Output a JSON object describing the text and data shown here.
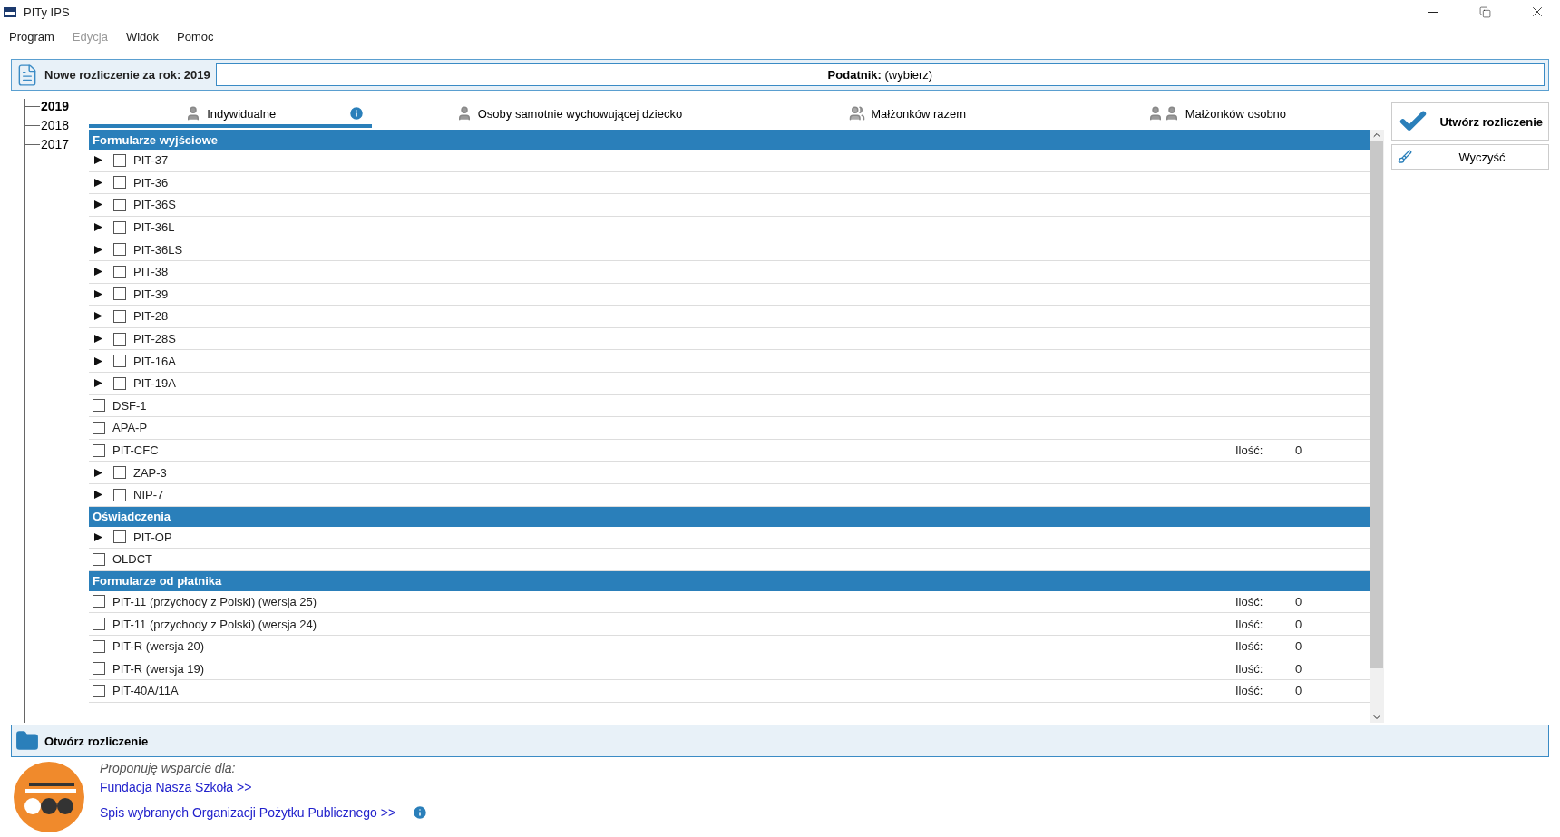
{
  "window": {
    "title": "PITy IPS"
  },
  "menu": [
    "Program",
    "Edycja",
    "Widok",
    "Pomoc"
  ],
  "menu_disabled": [
    false,
    true,
    false,
    false
  ],
  "header": {
    "title": "Nowe rozliczenie za rok: 2019",
    "taxpayer_label": "Podatnik:",
    "taxpayer_value": "(wybierz)"
  },
  "years": [
    {
      "label": "2019",
      "selected": true
    },
    {
      "label": "2018",
      "selected": false
    },
    {
      "label": "2017",
      "selected": false
    }
  ],
  "tabs": [
    {
      "label": "Indywidualne",
      "selected": true,
      "kind": "single",
      "info": true
    },
    {
      "label": "Osoby samotnie wychowującej dziecko",
      "selected": false,
      "kind": "single",
      "info": false
    },
    {
      "label": "Małżonków razem",
      "selected": false,
      "kind": "pair",
      "info": false
    },
    {
      "label": "Małżonków osobno",
      "selected": false,
      "kind": "apart",
      "info": false
    }
  ],
  "sections": [
    {
      "title": "Formularze wyjściowe",
      "items": [
        {
          "label": "PIT-37",
          "expandable": true,
          "checked": false
        },
        {
          "label": "PIT-36",
          "expandable": true,
          "checked": false
        },
        {
          "label": "PIT-36S",
          "expandable": true,
          "checked": false
        },
        {
          "label": "PIT-36L",
          "expandable": true,
          "checked": false
        },
        {
          "label": "PIT-36LS",
          "expandable": true,
          "checked": false
        },
        {
          "label": "PIT-38",
          "expandable": true,
          "checked": false
        },
        {
          "label": "PIT-39",
          "expandable": true,
          "checked": false
        },
        {
          "label": "PIT-28",
          "expandable": true,
          "checked": false
        },
        {
          "label": "PIT-28S",
          "expandable": true,
          "checked": false
        },
        {
          "label": "PIT-16A",
          "expandable": true,
          "checked": false
        },
        {
          "label": "PIT-19A",
          "expandable": true,
          "checked": false
        },
        {
          "label": "DSF-1",
          "expandable": false,
          "checked": false
        },
        {
          "label": "APA-P",
          "expandable": false,
          "checked": false
        },
        {
          "label": "PIT-CFC",
          "expandable": false,
          "checked": false,
          "quantity_label": "Ilość:",
          "quantity": "0"
        },
        {
          "label": "ZAP-3",
          "expandable": true,
          "checked": false
        },
        {
          "label": "NIP-7",
          "expandable": true,
          "checked": false
        }
      ]
    },
    {
      "title": "Oświadczenia",
      "items": [
        {
          "label": "PIT-OP",
          "expandable": true,
          "checked": false
        },
        {
          "label": "OLDCT",
          "expandable": false,
          "checked": false
        }
      ]
    },
    {
      "title": "Formularze od płatnika",
      "items": [
        {
          "label": "PIT-11 (przychody z Polski) (wersja 25)",
          "expandable": false,
          "checked": false,
          "quantity_label": "Ilość:",
          "quantity": "0"
        },
        {
          "label": "PIT-11 (przychody z Polski) (wersja 24)",
          "expandable": false,
          "checked": false,
          "quantity_label": "Ilość:",
          "quantity": "0"
        },
        {
          "label": "PIT-R (wersja 20)",
          "expandable": false,
          "checked": false,
          "quantity_label": "Ilość:",
          "quantity": "0"
        },
        {
          "label": "PIT-R (wersja 19)",
          "expandable": false,
          "checked": false,
          "quantity_label": "Ilość:",
          "quantity": "0"
        },
        {
          "label": "PIT-40A/11A",
          "expandable": false,
          "checked": false,
          "quantity_label": "Ilość:",
          "quantity": "0"
        }
      ]
    }
  ],
  "actions": [
    {
      "label": "Utwórz rozliczenie",
      "kind": "create"
    },
    {
      "label": "Wyczyść",
      "kind": "clear"
    }
  ],
  "open_bar": {
    "label": "Otwórz rozliczenie"
  },
  "support": {
    "intro": "Proponuję wsparcie dla:",
    "links": [
      "Fundacja Nasza Szkoła >>",
      "Spis wybranych Organizacji Pożytku Publicznego >>"
    ]
  }
}
